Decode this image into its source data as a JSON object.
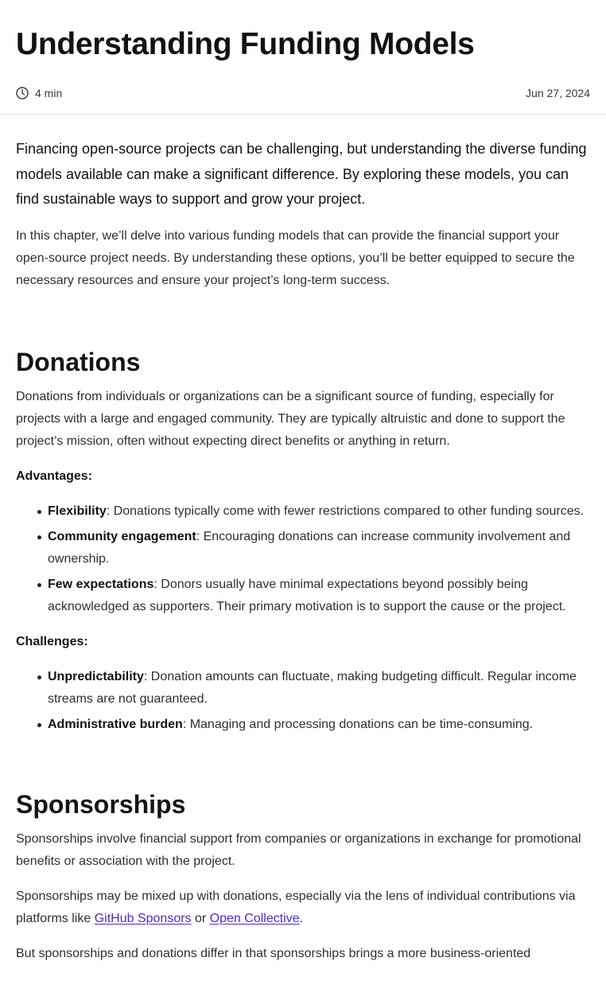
{
  "article": {
    "title": "Understanding Funding Models",
    "read_time": "4 min",
    "date": "Jun 27, 2024"
  },
  "intro": {
    "lead": "Financing open-source projects can be challenging, but understanding the diverse funding models available can make a significant difference. By exploring these models, you can find sustainable ways to support and grow your project.",
    "paragraph": "In this chapter, we’ll delve into various funding models that can provide the financial support your open-source project needs. By understanding these options, you’ll be better equipped to secure the necessary resources and ensure your project’s long-term success."
  },
  "donations": {
    "heading": "Donations",
    "paragraph": "Donations from individuals or organizations can be a significant source of funding, especially for projects with a large and engaged community. They are typically altruistic and done to support the project’s mission, often without expecting direct benefits or anything in return.",
    "advantages_label": "Advantages:",
    "advantages": [
      {
        "term": "Flexibility",
        "text": ": Donations typically come with fewer restrictions compared to other funding sources."
      },
      {
        "term": "Community engagement",
        "text": ": Encouraging donations can increase community involvement and ownership."
      },
      {
        "term": "Few expectations",
        "text": ": Donors usually have minimal expectations beyond possibly being acknowledged as supporters. Their primary motivation is to support the cause or the project."
      }
    ],
    "challenges_label": "Challenges:",
    "challenges": [
      {
        "term": "Unpredictability",
        "text": ": Donation amounts can fluctuate, making budgeting difficult. Regular income streams are not guaranteed."
      },
      {
        "term": "Administrative burden",
        "text": ": Managing and processing donations can be time-consuming."
      }
    ]
  },
  "sponsorships": {
    "heading": "Sponsorships",
    "paragraph1": "Sponsorships involve financial support from companies or organizations in exchange for promotional benefits or association with the project.",
    "p2_before": "Sponsorships may be mixed up with donations, especially via the lens of individual contributions via platforms like ",
    "link_github": "GitHub Sponsors",
    "p2_or": " or ",
    "link_opencollective": "Open Collective",
    "p2_after": ".",
    "paragraph3": "But sponsorships and donations differ in that sponsorships brings a more business-oriented"
  },
  "colors": {
    "link": "#4a2bd6",
    "text": "#2f2f2f",
    "heading": "#121212",
    "divider": "#e6e6e6"
  },
  "icons": {
    "read_time": "clock-icon"
  }
}
